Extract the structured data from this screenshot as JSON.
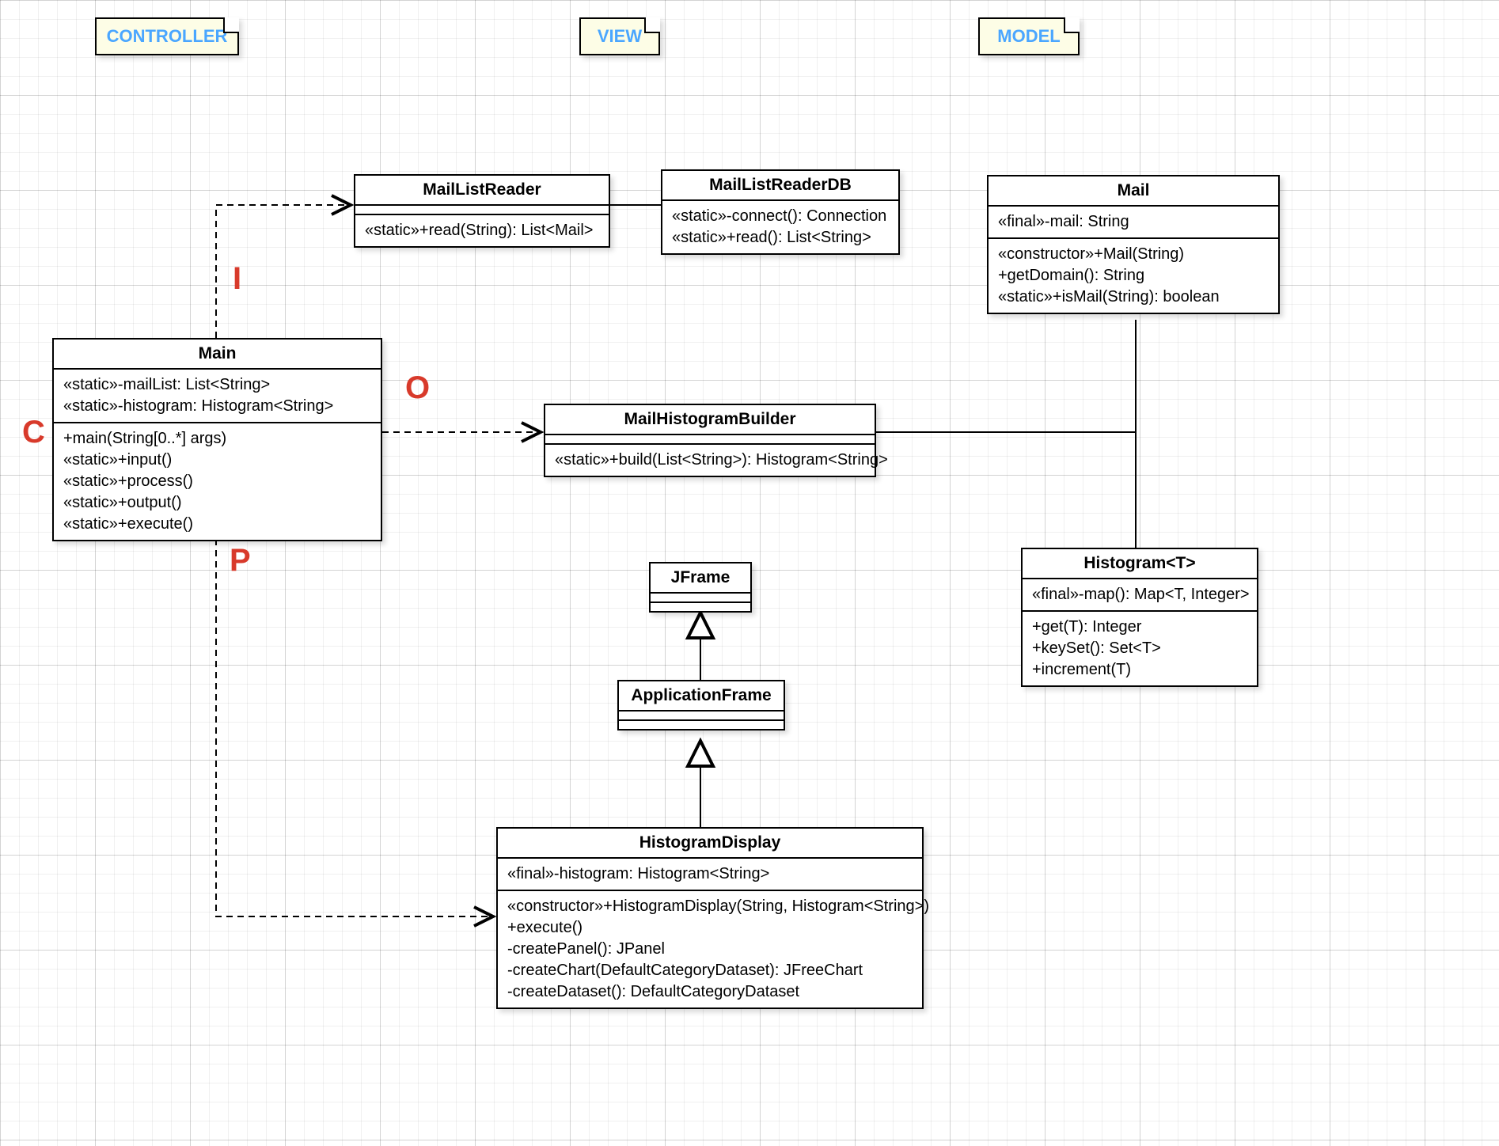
{
  "notes": {
    "controller": "CONTROLLER",
    "view": "VIEW",
    "model": "MODEL"
  },
  "annotations": {
    "C": "C",
    "I": "I",
    "O": "O",
    "P": "P"
  },
  "classes": {
    "Main": {
      "name": "Main",
      "attrs": [
        "«static»-mailList: List<String>",
        "«static»-histogram: Histogram<String>"
      ],
      "ops": [
        "+main(String[0..*] args)",
        "«static»+input()",
        "«static»+process()",
        "«static»+output()",
        "«static»+execute()"
      ]
    },
    "MailListReader": {
      "name": "MailListReader",
      "attrs": [],
      "ops": [
        "«static»+read(String): List<Mail>"
      ]
    },
    "MailListReaderDB": {
      "name": "MailListReaderDB",
      "attrs": [],
      "ops": [
        "«static»-connect(): Connection",
        "«static»+read(): List<String>"
      ]
    },
    "MailHistogramBuilder": {
      "name": "MailHistogramBuilder",
      "attrs": [],
      "ops": [
        "«static»+build(List<String>): Histogram<String>"
      ]
    },
    "JFrame": {
      "name": "JFrame"
    },
    "ApplicationFrame": {
      "name": "ApplicationFrame"
    },
    "HistogramDisplay": {
      "name": "HistogramDisplay",
      "attrs": [
        "«final»-histogram: Histogram<String>"
      ],
      "ops": [
        "«constructor»+HistogramDisplay(String, Histogram<String>)",
        "+execute()",
        "-createPanel(): JPanel",
        "-createChart(DefaultCategoryDataset): JFreeChart",
        "-createDataset(): DefaultCategoryDataset"
      ]
    },
    "Mail": {
      "name": "Mail",
      "attrs": [
        "«final»-mail: String"
      ],
      "ops": [
        "«constructor»+Mail(String)",
        "+getDomain(): String",
        "«static»+isMail(String): boolean"
      ]
    },
    "Histogram": {
      "name": "Histogram<T>",
      "attrs": [
        "«final»-map(): Map<T, Integer>"
      ],
      "ops": [
        "+get(T): Integer",
        "+keySet(): Set<T>",
        "+increment(T)"
      ]
    }
  }
}
